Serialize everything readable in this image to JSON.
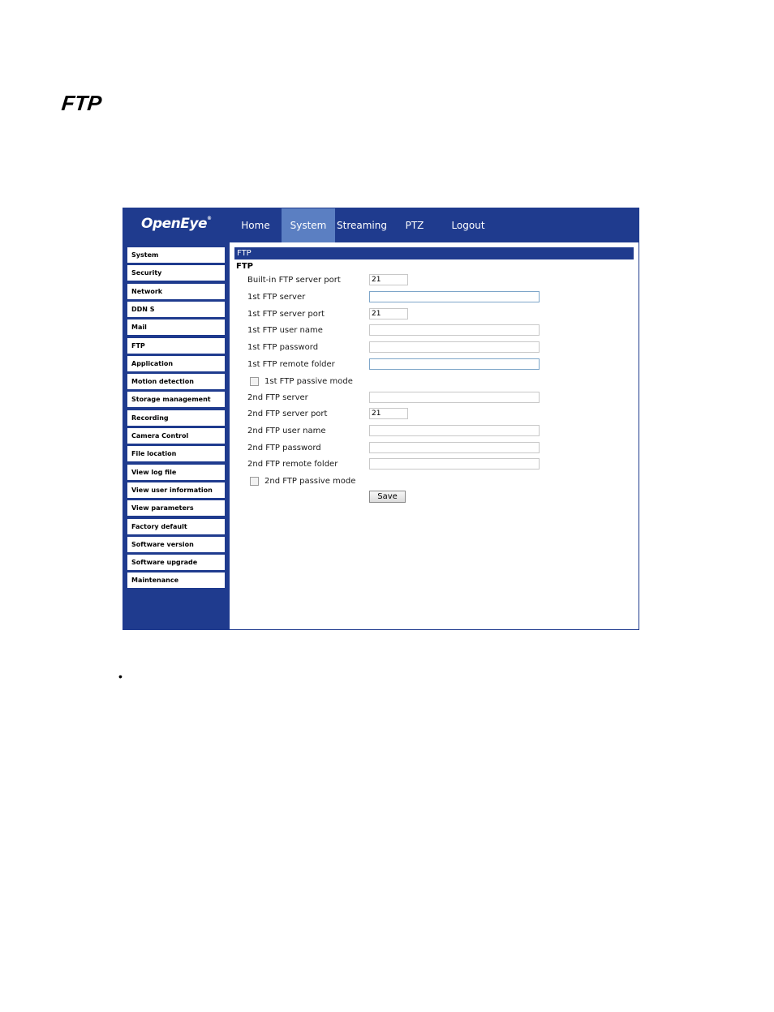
{
  "doc": {
    "heading": "FTP",
    "bullet": "•"
  },
  "ui": {
    "logo": "OpenEye",
    "logo_mark": "®",
    "nav": [
      {
        "label": "Home"
      },
      {
        "label": "System",
        "active": true
      },
      {
        "label": "Streaming"
      },
      {
        "label": "PTZ"
      },
      {
        "label": "Logout"
      }
    ],
    "sidebar": [
      "System",
      "Security",
      "Network",
      "DDN S",
      "Mail",
      "FTP",
      "Application",
      "Motion detection",
      "Storage management",
      "Recording",
      "Camera Control",
      "File location",
      "View log file",
      "View user information",
      "View parameters",
      "Factory default",
      "Software version",
      "Software upgrade",
      "Maintenance"
    ],
    "section_title": "FTP",
    "section_subtitle": "FTP",
    "fields": [
      {
        "label": "Built-in FTP server port",
        "value": "21",
        "size": "short"
      },
      {
        "label": "1st FTP server",
        "value": "",
        "size": "long",
        "highlight": true
      },
      {
        "label": "1st FTP server port",
        "value": "21",
        "size": "short"
      },
      {
        "label": "1st FTP user name",
        "value": "",
        "size": "long"
      },
      {
        "label": "1st FTP password",
        "value": "",
        "size": "long"
      },
      {
        "label": "1st FTP remote folder",
        "value": "",
        "size": "long",
        "highlight": true
      },
      {
        "checkbox": "1st FTP passive mode"
      },
      {
        "label": "2nd FTP server",
        "value": "",
        "size": "long"
      },
      {
        "label": "2nd FTP server port",
        "value": "21",
        "size": "short"
      },
      {
        "label": "2nd FTP user name",
        "value": "",
        "size": "long"
      },
      {
        "label": "2nd FTP password",
        "value": "",
        "size": "long"
      },
      {
        "label": "2nd FTP remote folder",
        "value": "",
        "size": "long"
      },
      {
        "checkbox": "2nd FTP passive mode"
      }
    ],
    "save_label": "Save",
    "colors": {
      "brand_blue": "#1f3b8e",
      "active_tab": "#5b7fc2"
    }
  }
}
